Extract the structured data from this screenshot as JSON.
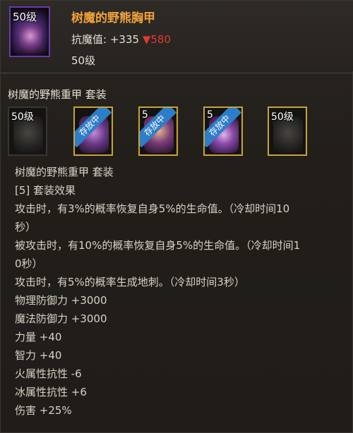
{
  "item": {
    "level_badge": "50级",
    "title": "树魔的野熊胸甲",
    "resist_label": "抗魔值:",
    "resist_value": "+335",
    "resist_drop_arrow": "▼",
    "resist_drop_value": "580",
    "level_text": "50级"
  },
  "set": {
    "title": "树魔的野熊重甲  套装",
    "slots": [
      {
        "level": "50级",
        "badge": "",
        "owned": false,
        "icon": "dark-shoulder-armor-icon"
      },
      {
        "level": "",
        "badge": "存放中",
        "owned": true,
        "icon": "purple-bracer-icon"
      },
      {
        "level": "5",
        "badge": "存放中",
        "owned": true,
        "icon": "purple-chest-armor-icon"
      },
      {
        "level": "5",
        "badge": "存放中",
        "owned": true,
        "icon": "purple-belt-icon"
      },
      {
        "level": "50级",
        "badge": "",
        "owned": true,
        "icon": "dark-boots-icon"
      }
    ]
  },
  "lines": [
    "树魔的野熊重甲  套装",
    "[5] 套装效果",
    "攻击时，有3%的概率恢复自身5%的生命值。（冷却时间10",
    "秒）",
    "被攻击时，有10%的概率恢复自身5%的生命值。（冷却时间1",
    "0秒）",
    "攻击时，有5%的概率生成地刺。（冷却时间3秒）",
    "物理防御力 +3000",
    "魔法防御力 +3000",
    "力量 +40",
    "智力 +40",
    "火属性抗性 -6",
    "冰属性抗性 +6",
    "伤害 +25%"
  ],
  "colors": {
    "title": "#f2a23a",
    "drop": "#e03a2e",
    "badge": "#2d7ec8",
    "owned_border": "#c8a33a"
  }
}
